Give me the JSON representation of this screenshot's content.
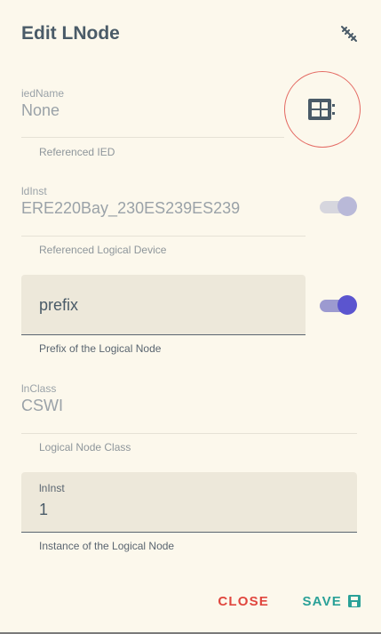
{
  "dialog": {
    "title": "Edit LNode",
    "header_icon": "link-off-icon",
    "fields": {
      "iedName": {
        "label": "iedName",
        "value": "None",
        "helper": "Referenced IED",
        "button_icon": "ied-select-icon"
      },
      "ldInst": {
        "label": "ldInst",
        "value": "ERE220Bay_230ES239ES239",
        "helper": "Referenced Logical Device",
        "toggle": false
      },
      "prefix": {
        "label": "prefix",
        "value": "",
        "helper": "Prefix of the Logical Node",
        "toggle": true
      },
      "lnClass": {
        "label": "lnClass",
        "value": "CSWI",
        "helper": "Logical Node Class"
      },
      "lnInst": {
        "label": "lnInst",
        "value": "1",
        "helper": "Instance of the Logical Node"
      }
    },
    "actions": {
      "close_label": "CLOSE",
      "save_label": "SAVE",
      "save_icon": "save-icon"
    },
    "colors": {
      "background": "#fcf8ec",
      "accent": "#5b55cf",
      "close": "#e0463e",
      "save": "#2aa198",
      "highlight": "#e46a63"
    }
  }
}
